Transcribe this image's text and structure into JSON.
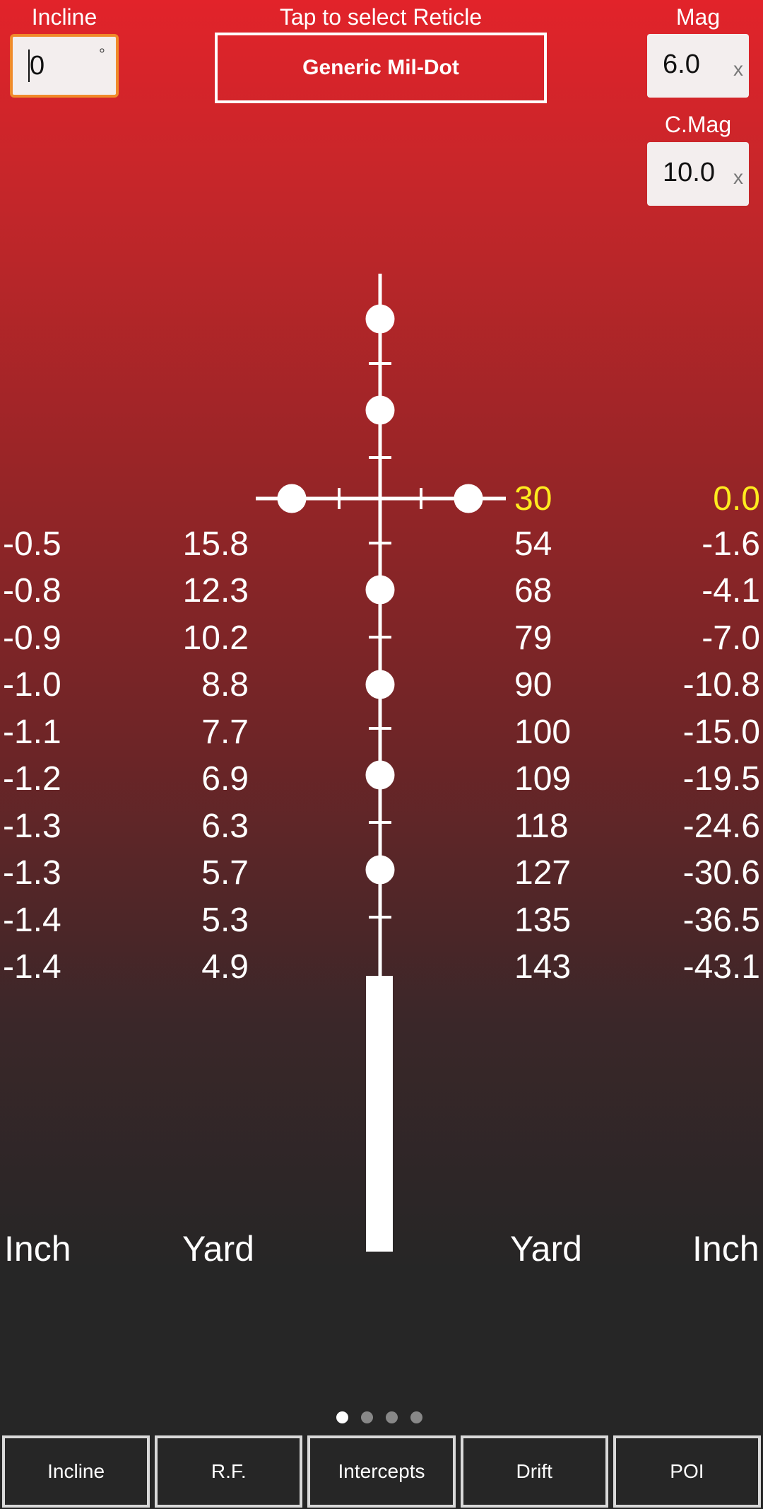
{
  "header": {
    "incline_label": "Incline",
    "incline_value": "0",
    "incline_unit": "°",
    "reticle_label": "Tap to select Reticle",
    "reticle_name": "Generic Mil-Dot",
    "mag_label": "Mag",
    "mag_value": "6.0",
    "mag_unit": "x",
    "cmag_label": "C.Mag",
    "cmag_value": "10.0",
    "cmag_unit": "x"
  },
  "ranging_rows": {
    "zero": {
      "yard_right": "30",
      "inch_right": "0.0"
    },
    "rows": [
      {
        "inch_left": "-0.5",
        "yard_left": "15.8",
        "yard_right": "54",
        "inch_right": "-1.6"
      },
      {
        "inch_left": "-0.8",
        "yard_left": "12.3",
        "yard_right": "68",
        "inch_right": "-4.1"
      },
      {
        "inch_left": "-0.9",
        "yard_left": "10.2",
        "yard_right": "79",
        "inch_right": "-7.0"
      },
      {
        "inch_left": "-1.0",
        "yard_left": "8.8",
        "yard_right": "90",
        "inch_right": "-10.8"
      },
      {
        "inch_left": "-1.1",
        "yard_left": "7.7",
        "yard_right": "100",
        "inch_right": "-15.0"
      },
      {
        "inch_left": "-1.2",
        "yard_left": "6.9",
        "yard_right": "109",
        "inch_right": "-19.5"
      },
      {
        "inch_left": "-1.3",
        "yard_left": "6.3",
        "yard_right": "118",
        "inch_right": "-24.6"
      },
      {
        "inch_left": "-1.3",
        "yard_left": "5.7",
        "yard_right": "127",
        "inch_right": "-30.6"
      },
      {
        "inch_left": "-1.4",
        "yard_left": "5.3",
        "yard_right": "135",
        "inch_right": "-36.5"
      },
      {
        "inch_left": "-1.4",
        "yard_left": "4.9",
        "yard_right": "143",
        "inch_right": "-43.1"
      }
    ]
  },
  "units": {
    "inch_left": "Inch",
    "yard_left": "Yard",
    "yard_right": "Yard",
    "inch_right": "Inch"
  },
  "colors": {
    "highlight": "#ffeb1e",
    "focus_border": "#f08a2a"
  },
  "pager": {
    "count": 4,
    "active": 1
  },
  "tabs": [
    "Incline",
    "R.F.",
    "Intercepts",
    "Drift",
    "POI"
  ]
}
